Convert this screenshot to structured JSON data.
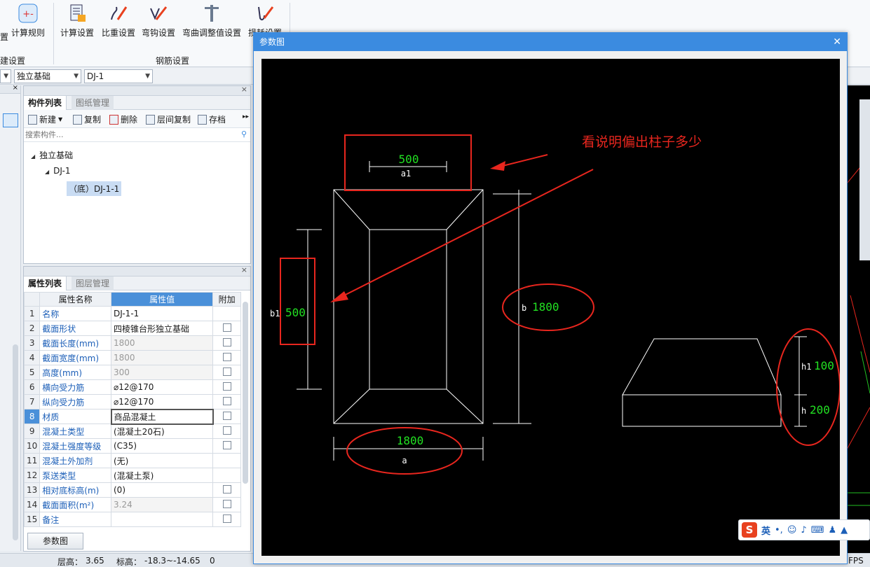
{
  "ribbon": {
    "partial_left_label": "置",
    "rule_label": "计算规则",
    "buttons": [
      {
        "label": "计算设置",
        "icon": "calc-settings-icon"
      },
      {
        "label": "比重设置",
        "icon": "density-settings-icon"
      },
      {
        "label": "弯钩设置",
        "icon": "hook-settings-icon"
      },
      {
        "label": "弯曲调整值设置",
        "icon": "bend-adjust-icon"
      },
      {
        "label": "损耗设置",
        "icon": "loss-settings-icon"
      }
    ],
    "group_left": "建设置",
    "group_rebar": "钢筋设置"
  },
  "combos": {
    "type": "独立基础",
    "item": "DJ-1"
  },
  "component_panel": {
    "tab_active": "构件列表",
    "tab_inactive": "图纸管理",
    "toolbar": {
      "new": "新建",
      "copy": "复制",
      "delete": "删除",
      "floor_copy": "层间复制",
      "save": "存档"
    },
    "search_placeholder": "搜索构件...",
    "tree": {
      "root": "独立基础",
      "child": "DJ-1",
      "leaf": "（底）DJ-1-1"
    }
  },
  "property_panel": {
    "tab_active": "属性列表",
    "tab_inactive": "图层管理",
    "headers": {
      "name": "属性名称",
      "value": "属性值",
      "extra": "附加"
    },
    "rows": [
      {
        "no": "1",
        "name": "名称",
        "value": "DJ-1-1",
        "gray": false,
        "checkbox": false
      },
      {
        "no": "2",
        "name": "截面形状",
        "value": "四棱锥台形独立基础",
        "gray": false,
        "checkbox": true
      },
      {
        "no": "3",
        "name": "截面长度(mm)",
        "value": "1800",
        "gray": true,
        "checkbox": true
      },
      {
        "no": "4",
        "name": "截面宽度(mm)",
        "value": "1800",
        "gray": true,
        "checkbox": true
      },
      {
        "no": "5",
        "name": "高度(mm)",
        "value": "300",
        "gray": true,
        "checkbox": true
      },
      {
        "no": "6",
        "name": "横向受力筋",
        "value": "⌀12@170",
        "gray": false,
        "checkbox": true
      },
      {
        "no": "7",
        "name": "纵向受力筋",
        "value": "⌀12@170",
        "gray": false,
        "checkbox": true
      },
      {
        "no": "8",
        "name": "材质",
        "value": "商品混凝土",
        "gray": false,
        "checkbox": true
      },
      {
        "no": "9",
        "name": "混凝土类型",
        "value": "(混凝土20石)",
        "gray": false,
        "checkbox": true
      },
      {
        "no": "10",
        "name": "混凝土强度等级",
        "value": "(C35)",
        "gray": false,
        "checkbox": true
      },
      {
        "no": "11",
        "name": "混凝土外加剂",
        "value": "(无)",
        "gray": false,
        "checkbox": false
      },
      {
        "no": "12",
        "name": "泵送类型",
        "value": "(混凝土泵)",
        "gray": false,
        "checkbox": false
      },
      {
        "no": "13",
        "name": "相对底标高(m)",
        "value": "(0)",
        "gray": false,
        "checkbox": true
      },
      {
        "no": "14",
        "name": "截面面积(m²)",
        "value": "3.24",
        "gray": true,
        "checkbox": true
      },
      {
        "no": "15",
        "name": "备注",
        "value": "",
        "gray": false,
        "checkbox": true
      }
    ],
    "selected_row": "8",
    "param_button": "参数图"
  },
  "dialog": {
    "title": "参数图",
    "annotation": "看说明偏出柱子多少",
    "dims": {
      "a1_value": "500",
      "a1_label": "a1",
      "b1_label": "b1",
      "b1_value": "500",
      "b_label": "b",
      "b_value": "1800",
      "a_value": "1800",
      "a_label": "a",
      "h1_label": "h1",
      "h1_value": "100",
      "h_label": "h",
      "h_value": "200"
    },
    "colors": {
      "dim_value": "#22e022",
      "annotation": "#e8261e",
      "line": "#ffffff"
    }
  },
  "statusbar": {
    "floor_height_label": "层高：",
    "floor_height": "3.65",
    "elev_label": "标高：",
    "elev": "-18.3~-14.65",
    "count": "0",
    "fps": "FPS"
  },
  "ime": {
    "logo": "S",
    "mode": "英"
  }
}
